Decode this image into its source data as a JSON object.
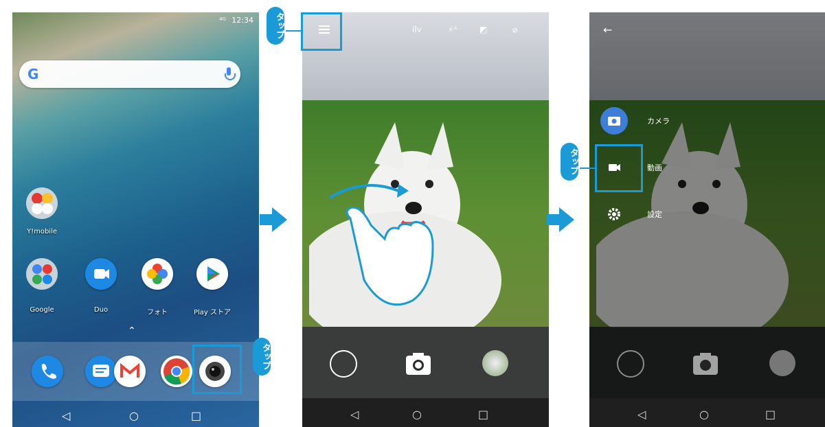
{
  "home": {
    "status_time": "12:34",
    "status_signal": "⁴ᴳ",
    "search_logo": "G",
    "folder_ymobile_label": "Y!mobile",
    "apps": [
      {
        "label": "Google",
        "color": "#e6e6e6"
      },
      {
        "label": "Duo",
        "color": "#1e88e5"
      },
      {
        "label": "フォト",
        "color": "#ffffff"
      },
      {
        "label": "Play ストア",
        "color": "#ffffff"
      }
    ],
    "dock_apps": [
      {
        "name": "phone",
        "color": "#1e88e5"
      },
      {
        "name": "messages",
        "color": "#1e88e5"
      },
      {
        "name": "gmail",
        "color": "#ffffff"
      },
      {
        "name": "chrome",
        "color": "#ffffff"
      },
      {
        "name": "camera",
        "color": "#ffffff"
      }
    ]
  },
  "camera": {
    "top_icons": [
      "ilv",
      "⚡ᴬ",
      "◩",
      "⌀"
    ]
  },
  "menu": {
    "items": [
      {
        "label": "カメラ",
        "icon": "camera-icon"
      },
      {
        "label": "動画",
        "icon": "video-icon"
      },
      {
        "label": "設定",
        "icon": "gear-icon"
      }
    ]
  },
  "callout_text": "タップ",
  "colors": {
    "accent": "#1a9ad6"
  }
}
